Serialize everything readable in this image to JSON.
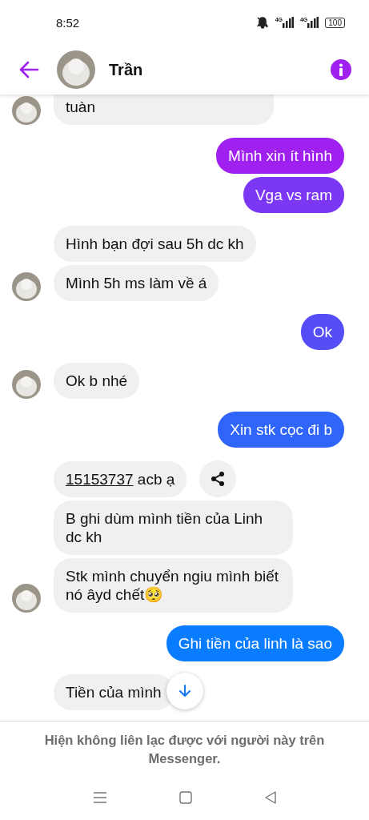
{
  "status_bar": {
    "time": "8:52",
    "networks": [
      "4G",
      "4G"
    ],
    "battery": "100"
  },
  "header": {
    "name": "Trần"
  },
  "groups": [
    {
      "kind": "incoming",
      "avatar": true,
      "messages": [
        {
          "text": "tuàn",
          "cut": true
        }
      ]
    },
    {
      "kind": "outgoing",
      "messages": [
        {
          "text": "Mình xin ít hình"
        },
        {
          "text": "Vga vs ram"
        }
      ]
    },
    {
      "kind": "incoming",
      "avatar": true,
      "messages": [
        {
          "text": "Hình bạn đợi sau 5h dc kh"
        },
        {
          "text": "Mình 5h ms làm về á"
        }
      ]
    },
    {
      "kind": "outgoing",
      "messages": [
        {
          "text": "Ok"
        }
      ]
    },
    {
      "kind": "incoming",
      "avatar": true,
      "messages": [
        {
          "text": "Ok b nhé"
        }
      ]
    },
    {
      "kind": "outgoing",
      "messages": [
        {
          "text": "Xin stk cọc đi b"
        }
      ]
    },
    {
      "kind": "incoming",
      "avatar": true,
      "messages": [
        {
          "link": "15153737",
          "text": "acb ạ",
          "share": true
        },
        {
          "text": "B ghi dùm mình tiền của Linh dc kh"
        },
        {
          "text": "Stk mình chuyển ngiu mình biết nó âyd chết🥺"
        }
      ]
    },
    {
      "kind": "outgoing",
      "messages": [
        {
          "text": "Ghi tiền của linh là sao"
        }
      ]
    },
    {
      "kind": "incoming",
      "avatar": false,
      "messages": [
        {
          "text": "Tiền của mình"
        }
      ]
    }
  ],
  "notice": "Hiện không liên lạc được với người này trên Messenger."
}
